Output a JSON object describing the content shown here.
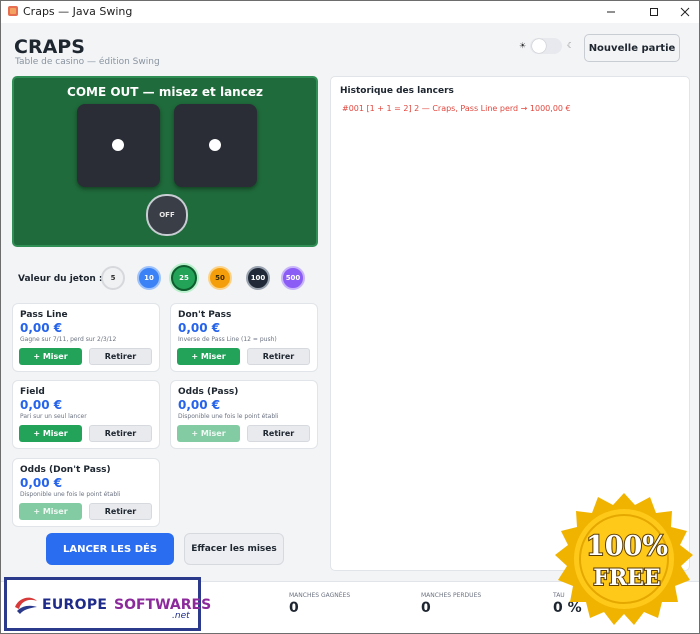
{
  "window": {
    "title": "Craps — Java Swing"
  },
  "header": {
    "title": "CRAPS",
    "subtitle": "Table de casino — édition Swing",
    "theme_light_glyph": "☀",
    "theme_dark_glyph": "☾",
    "new_game_label": "Nouvelle partie"
  },
  "table": {
    "phase": "COME OUT — misez et lancez",
    "dice": [
      1,
      1
    ],
    "puck": "OFF",
    "felt_color": "#1f6b3b"
  },
  "chips": {
    "label": "Valeur du jeton :",
    "values": [
      "5",
      "10",
      "25",
      "50",
      "100",
      "500"
    ],
    "selected": "25"
  },
  "bets": [
    {
      "name": "Pass Line",
      "amount": "0,00 €",
      "desc": "Gagne sur 7/11, perd sur 2/3/12",
      "bet_label": "+ Miser",
      "remove_label": "Retirer",
      "enabled": true
    },
    {
      "name": "Don't Pass",
      "amount": "0,00 €",
      "desc": "Inverse de Pass Line (12 = push)",
      "bet_label": "+ Miser",
      "remove_label": "Retirer",
      "enabled": true
    },
    {
      "name": "Field",
      "amount": "0,00 €",
      "desc": "Pari sur un seul lancer",
      "bet_label": "+ Miser",
      "remove_label": "Retirer",
      "enabled": true
    },
    {
      "name": "Odds (Pass)",
      "amount": "0,00 €",
      "desc": "Disponible une fois le point établi",
      "bet_label": "+ Miser",
      "remove_label": "Retirer",
      "enabled": false
    },
    {
      "name": "Odds (Don't Pass)",
      "amount": "0,00 €",
      "desc": "Disponible une fois le point établi",
      "bet_label": "+ Miser",
      "remove_label": "Retirer",
      "enabled": false
    }
  ],
  "actions": {
    "roll_label": "LANCER LES DÉS",
    "clear_label": "Effacer les mises"
  },
  "history": {
    "title": "Historique des lancers",
    "entries": [
      "#001  [1 + 1 = 2]   2 — Craps, Pass Line perd   →  1000,00 €"
    ]
  },
  "stats": {
    "won_label": "MANCHES GAGNÉES",
    "won_value": "0",
    "lost_label": "MANCHES PERDUES",
    "lost_value": "0",
    "rate_label": "TAU",
    "rate_value": "0 %"
  },
  "watermark": {
    "logo_main": "EUROPE",
    "logo_accent": "SOFTWARES",
    "logo_suffix": ".net",
    "seal_line1": "100%",
    "seal_line2": "FREE"
  },
  "colors": {
    "accent_blue": "#2b6df0",
    "bet_green": "#23a35a",
    "loss_red": "#e0483f"
  }
}
